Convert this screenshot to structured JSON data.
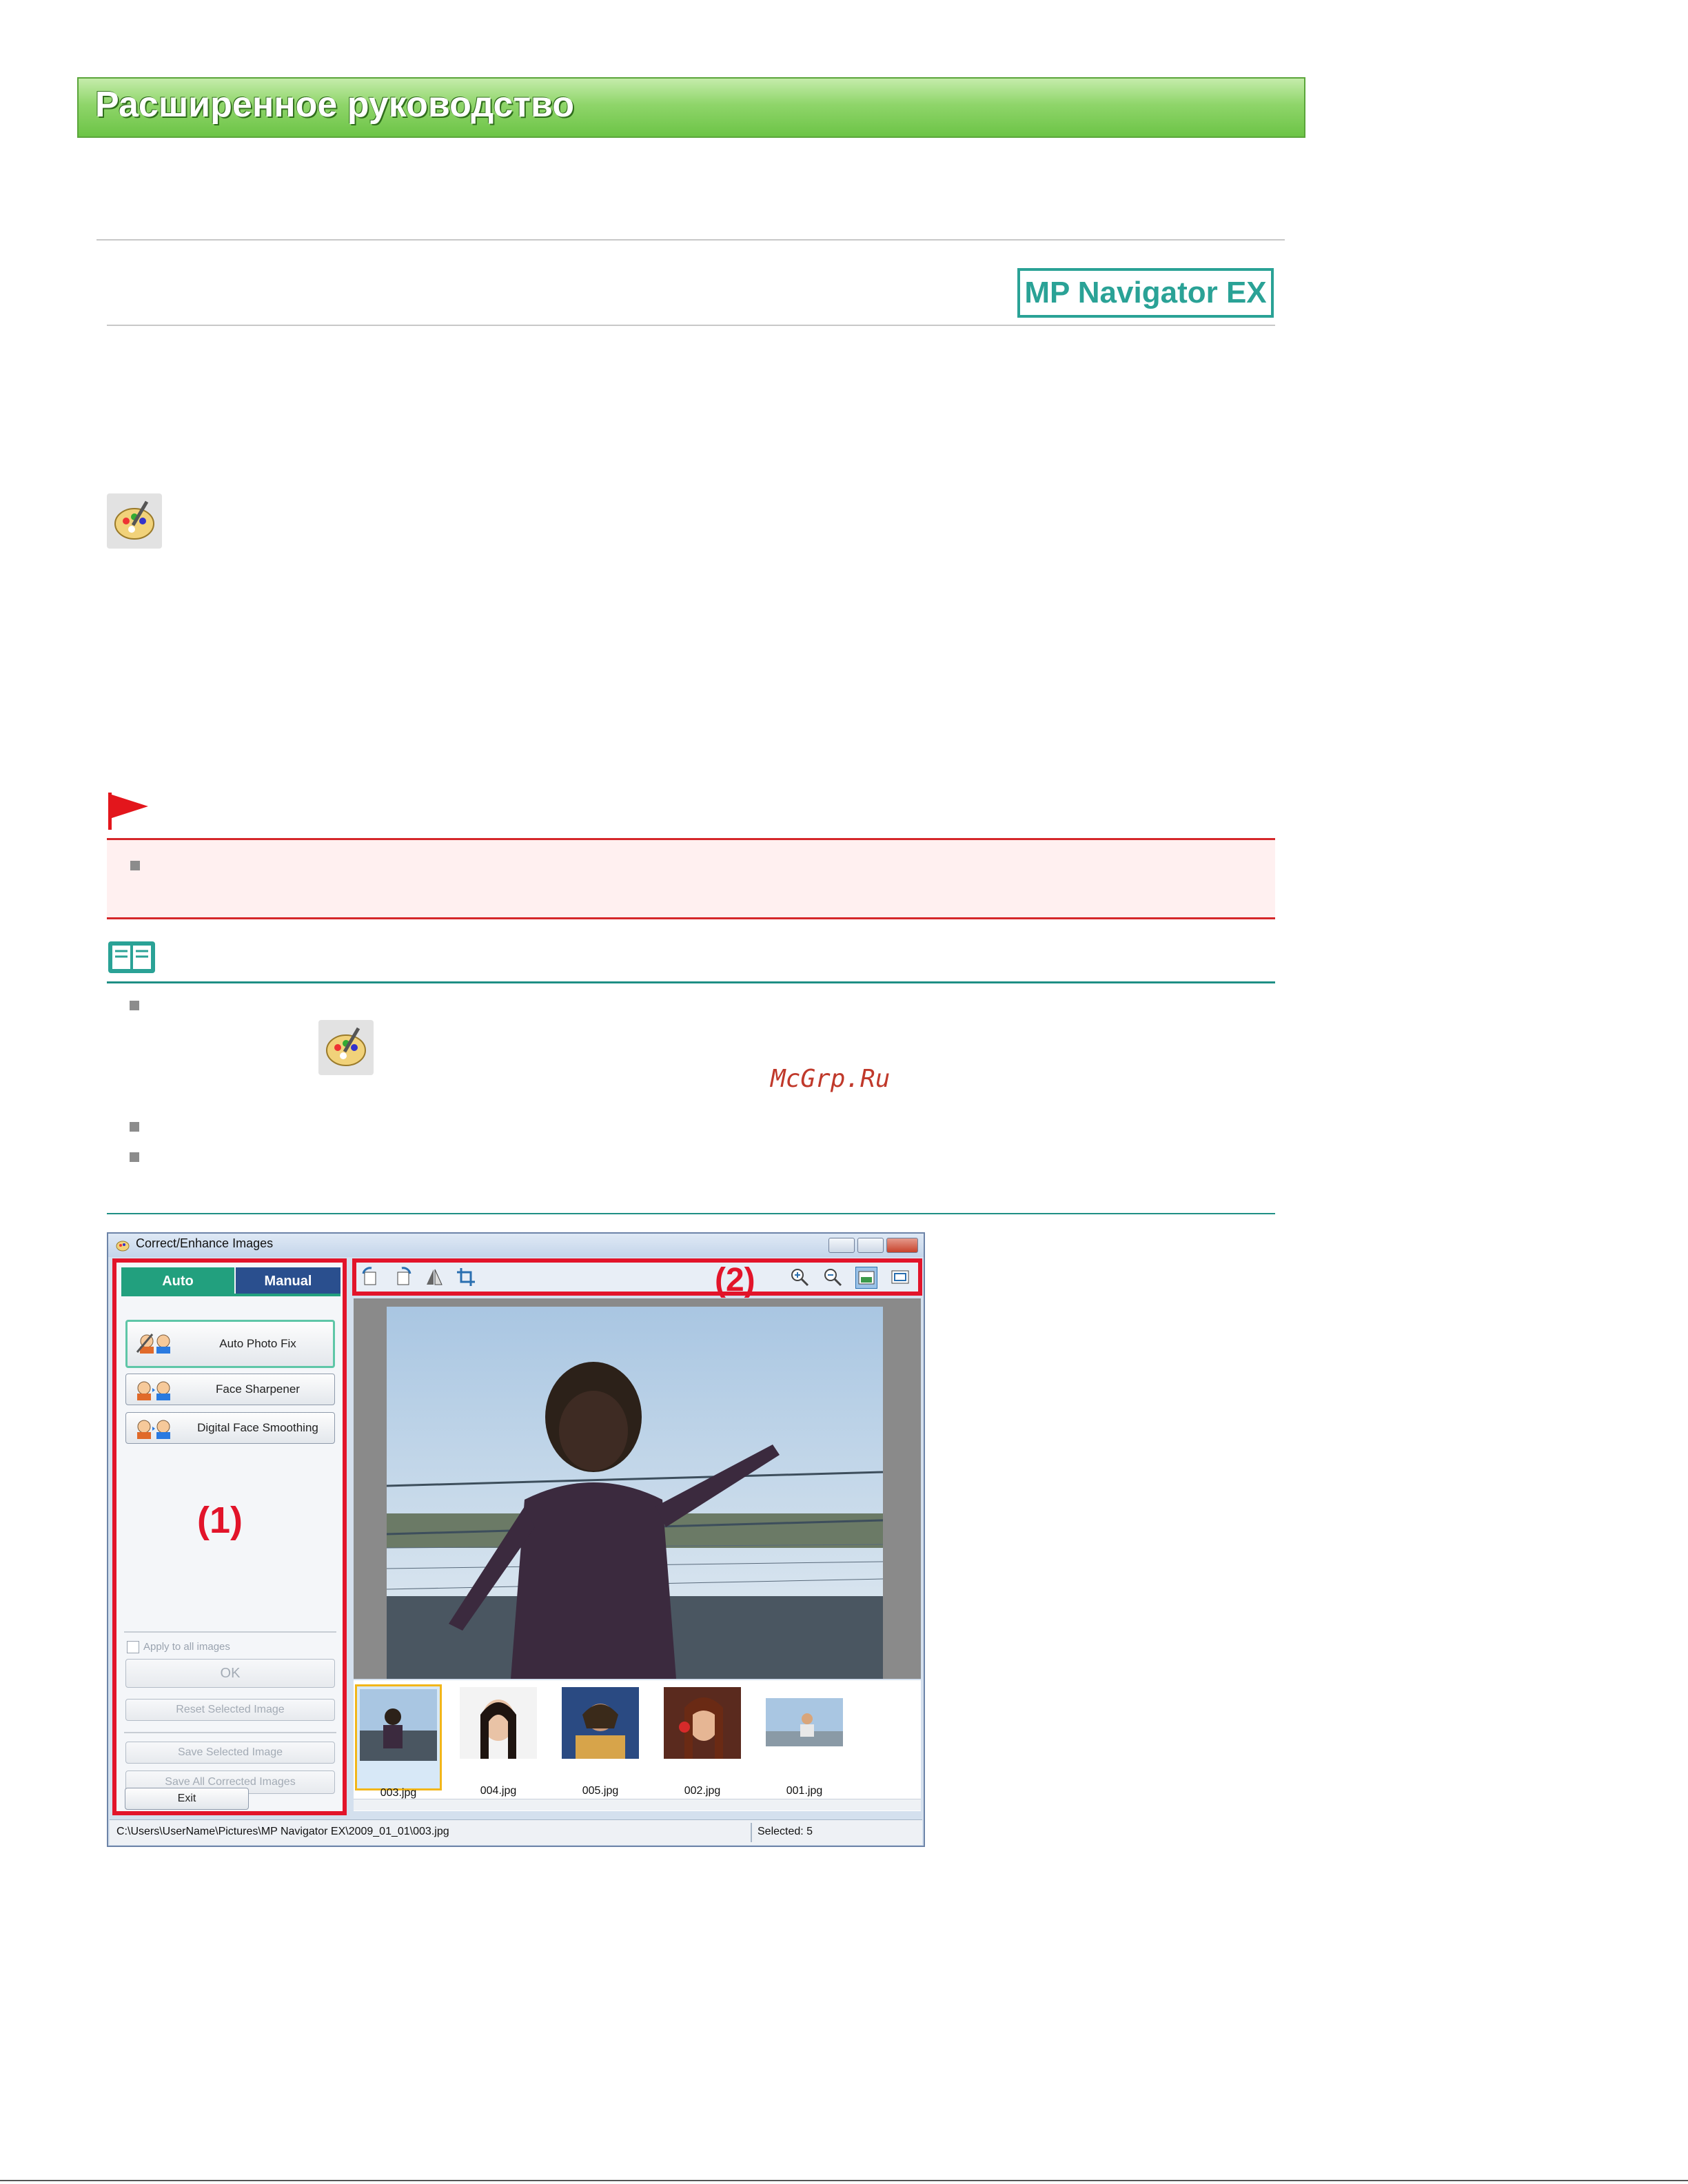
{
  "header": {
    "title": "Расширенное руководство"
  },
  "brand": {
    "label": "MP Navigator EX"
  },
  "watermark": "McGrp.Ru",
  "icons": {
    "correct_enhance": "palette-brush-icon",
    "important": "red-flag-icon",
    "note": "open-book-icon"
  },
  "colors": {
    "banner": "#6cc446",
    "brand": "#2aa296",
    "important": "#d5272a",
    "note": "#1f8f85",
    "callout": "#e2142a"
  },
  "window": {
    "title": "Correct/Enhance Images",
    "tabs": {
      "auto": "Auto",
      "manual": "Manual"
    },
    "buttons": {
      "auto_photo_fix": "Auto Photo Fix",
      "face_sharpener": "Face Sharpener",
      "digital_face_smoothing": "Digital Face Smoothing",
      "ok": "OK",
      "reset": "Reset Selected Image",
      "save_selected": "Save Selected Image",
      "save_all": "Save All Corrected Images",
      "exit": "Exit"
    },
    "apply_all": "Apply to all images",
    "callouts": {
      "one": "(1)",
      "two": "(2)"
    },
    "thumbnails": [
      {
        "name": "003.jpg"
      },
      {
        "name": "004.jpg"
      },
      {
        "name": "005.jpg"
      },
      {
        "name": "002.jpg"
      },
      {
        "name": "001.jpg"
      }
    ],
    "status": {
      "path": "C:\\Users\\UserName\\Pictures\\MP Navigator EX\\2009_01_01\\003.jpg",
      "selected": "Selected: 5"
    }
  }
}
